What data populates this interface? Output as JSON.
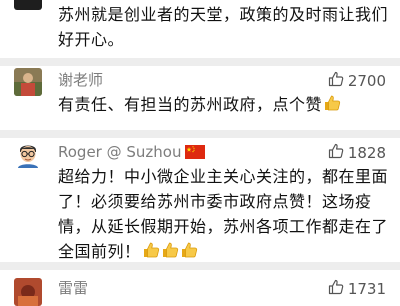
{
  "top_comment": {
    "lines": [
      "苏州就是创业者的天堂，政策的及时雨让我们",
      "好开心。"
    ]
  },
  "comments": [
    {
      "author": "谢老师",
      "likes": "2700",
      "lines": [
        "有责任、有担当的苏州政府，点个赞"
      ],
      "emoji_count": 1
    },
    {
      "author": "Roger @ Suzhou",
      "likes": "1828",
      "lines": [
        "超给力！中小微企业主关心关注的，都在里面",
        "了！必须要给苏州市委市政府点赞！这场疫",
        "情，从延长假期开始，苏州各项工作都走在了",
        "全国前列！"
      ],
      "emoji_count": 3
    },
    {
      "author": "雷雷",
      "likes": "1731"
    }
  ],
  "icons": {
    "like": "thumbs-up-outline-icon",
    "emoji": "thumbs-up-emoji-icon",
    "flag": "china-flag-icon"
  },
  "colors": {
    "divider": "#ededed",
    "name": "#7d7d7d",
    "text": "#111111"
  }
}
